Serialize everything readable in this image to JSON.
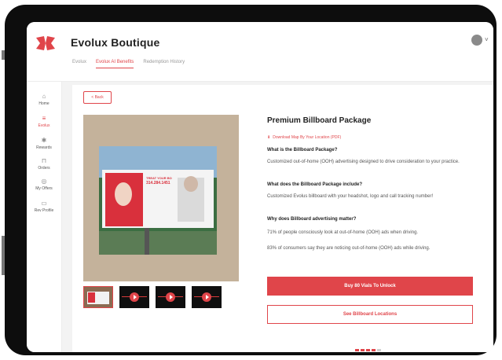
{
  "header": {
    "brand": "Evolux Boutique",
    "subnav": [
      "Evolux",
      "Evolux AI Benefits",
      "Redemption History"
    ],
    "avatar_chevron": "˅"
  },
  "sidebar": {
    "items": [
      {
        "label": "Home",
        "icon": "⌂",
        "icon_name": "home-icon"
      },
      {
        "label": "Evolux",
        "icon": "≡",
        "icon_name": "evolux-icon"
      },
      {
        "label": "Rewards",
        "icon": "✱",
        "icon_name": "rewards-icon"
      },
      {
        "label": "Orders",
        "icon": "⊓",
        "icon_name": "orders-icon"
      },
      {
        "label": "My Offers",
        "icon": "◎",
        "icon_name": "offers-icon"
      },
      {
        "label": "Rev Profile",
        "icon": "▭",
        "icon_name": "profile-icon"
      }
    ],
    "active_index": 1
  },
  "content": {
    "back_label": "< Back",
    "title": "Premium Billboard Package",
    "download_label": "Download Map By Your Location (PDF)",
    "download_icon": "⬇",
    "sections": [
      {
        "q": "What is the Billboard Package?",
        "a": [
          "Customized out-of-home (OOH) advertising designed to drive consideration to your practice."
        ]
      },
      {
        "q": "What does the Billboard Package include?",
        "a": [
          "Customized Evolus billboard with your headshot, logo and call tracking number!"
        ]
      },
      {
        "q": "Why does Billboard advertising matter?",
        "a": [
          "71% of people consciously look at out-of-home (OOH) ads when driving.",
          "83% of consumers say they are noticing out-of-home (OOH) ads while driving."
        ]
      }
    ],
    "billboard_text_1": "TREAT YOUR BO",
    "billboard_text_2": "314.284.1451",
    "buy_label": "Buy 80 Vials To Unlock",
    "locations_label": "See Billboard Locations"
  },
  "colors": {
    "accent": "#e0454a",
    "text": "#222222",
    "muted": "#555555"
  }
}
